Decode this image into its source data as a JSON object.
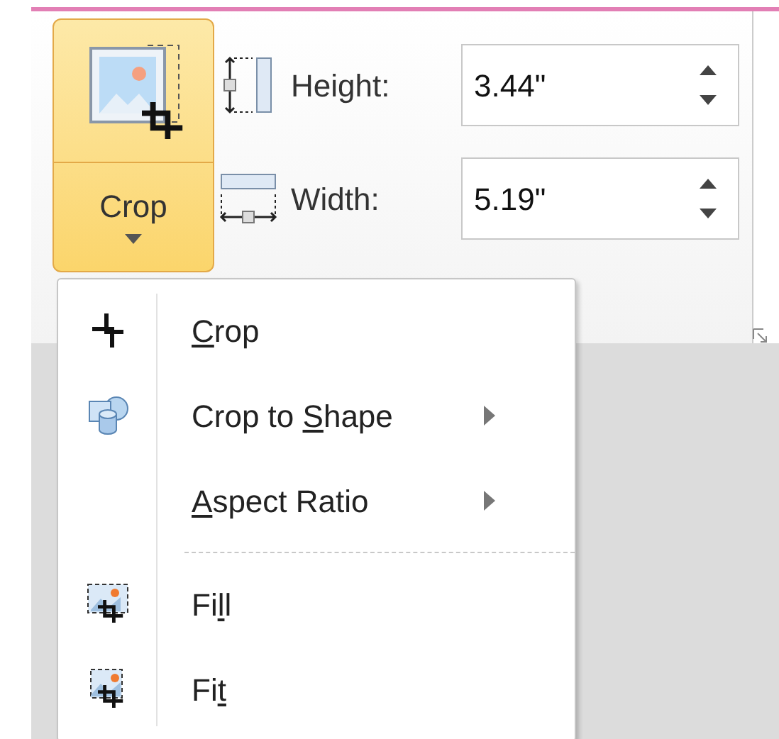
{
  "crop_button": {
    "label": "Crop",
    "open": true
  },
  "size_fields": [
    {
      "kind": "height",
      "label": "Height:",
      "value": "3.44\""
    },
    {
      "kind": "width",
      "label": "Width:",
      "value": "5.19\""
    }
  ],
  "menu": [
    {
      "kind": "crop",
      "key": "C",
      "after": "rop",
      "has_submenu": false
    },
    {
      "kind": "shape",
      "before": "Crop to ",
      "key": "S",
      "after": "hape",
      "has_submenu": true
    },
    {
      "kind": "plain",
      "key": "A",
      "after": "spect Ratio",
      "has_submenu": true
    },
    {
      "kind": "separator"
    },
    {
      "kind": "fill",
      "before": "Fi",
      "key": "l",
      "after": "l",
      "has_submenu": false
    },
    {
      "kind": "fit",
      "before": "Fi",
      "key": "t",
      "has_submenu": false
    }
  ]
}
